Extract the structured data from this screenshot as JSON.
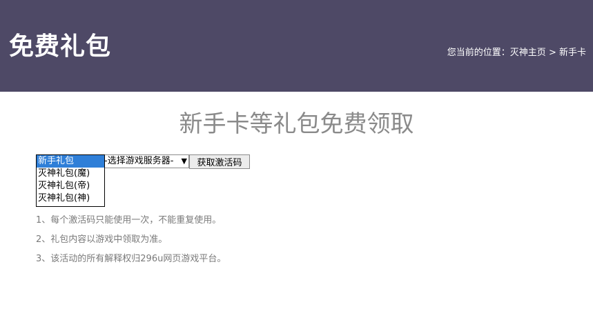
{
  "header": {
    "title": "免费礼包",
    "breadcrumb": {
      "prefix": "您当前的位置：",
      "home": "灭神主页",
      "separator": " > ",
      "current": "新手卡"
    }
  },
  "main": {
    "title": "新手卡等礼包免费领取"
  },
  "form": {
    "gift_options": [
      "新手礼包",
      "灭神礼包(魔)",
      "灭神礼包(帝)",
      "灭神礼包(神)"
    ],
    "selected_gift": "新手礼包",
    "server_select_value": "-选择游戏服务器-",
    "get_code_label": "获取激活码"
  },
  "notes": [
    "1、每个激活码只能使用一次，不能重复使用。",
    "2、礼包内容以游戏中领取为准。",
    "3、该活动的所有解释权归296u网页游戏平台。"
  ],
  "colors": {
    "header_bg": "#4e4966",
    "title_text": "#8a8a8a",
    "selected_option_bg": "#2f7fd8"
  }
}
